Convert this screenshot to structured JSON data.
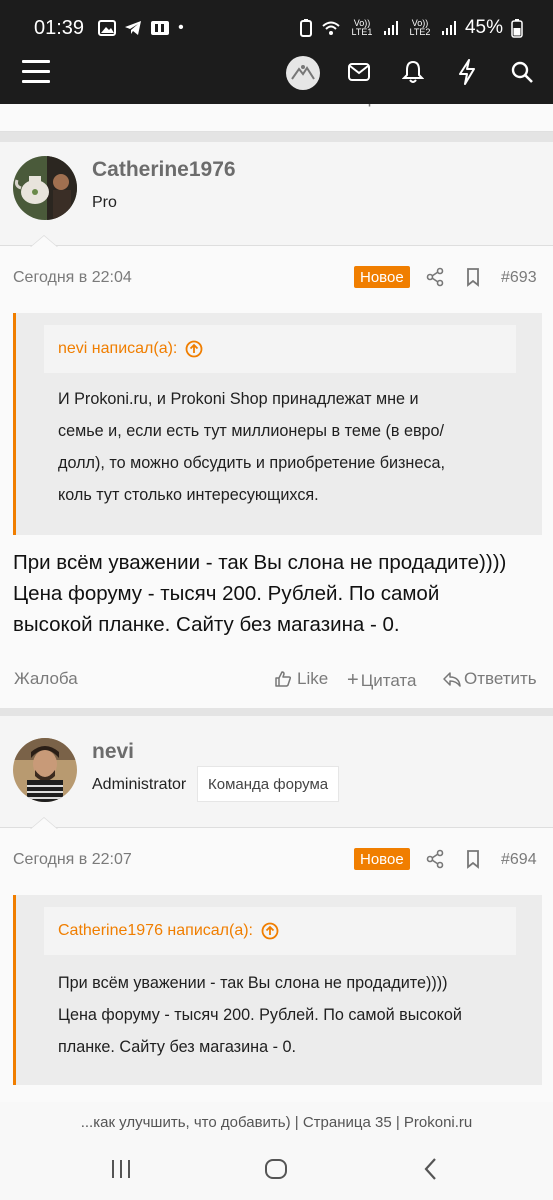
{
  "status_bar": {
    "time": "01:39",
    "dot": "•",
    "sim1_label": "Vo)) LTE1",
    "sim2_label": "Vo)) LTE2",
    "battery_percent": "45%"
  },
  "nav": {
    "icons": [
      "menu-icon",
      "site-logo-icon",
      "inbox-icon",
      "bell-icon",
      "bolt-icon",
      "search-icon"
    ]
  },
  "prev_post_footer": {
    "report": "Жалоба",
    "like": "Like",
    "quote": "Цитата",
    "reply": "Ответить"
  },
  "posts": [
    {
      "username": "Catherine1976",
      "user_title": "Pro",
      "user_badge": "",
      "time": "Сегодня в 22:04",
      "new_label": "Новое",
      "post_number": "#693",
      "quote_author": "nevi написал(а):",
      "quote_lines": [
        "И Prokoni.ru, и Prokoni Shop принадлежат мне и",
        "семье и, если есть тут миллионеры в теме (в евро/",
        "долл), то можно обсудить и приобретение бизнеса,",
        "коль тут столько интересующихся."
      ],
      "message_lines": [
        "При всём уважении - так Вы слона не продадите))))",
        "Цена форуму - тысяч 200. Рублей. По самой",
        "высокой планке. Сайту без магазина - 0."
      ],
      "report": "Жалоба",
      "like": "Like",
      "quote": "Цитата",
      "reply": "Ответить"
    },
    {
      "username": "nevi",
      "user_title": "Administrator",
      "user_badge": "Команда форума",
      "time": "Сегодня в 22:07",
      "new_label": "Новое",
      "post_number": "#694",
      "quote_author": "Catherine1976 написал(а):",
      "quote_lines": [
        "При всём уважении - так Вы слона не продадите))))",
        "Цена форуму - тысяч 200. Рублей. По самой высокой",
        "планке. Сайту без магазина - 0."
      ]
    }
  ],
  "page_title": "...как улучшить, что добавить) | Страница 35 | Prokoni.ru",
  "system_nav": [
    "recent-apps-icon",
    "home-icon",
    "back-icon"
  ],
  "colors": {
    "accent": "#f07e00",
    "topbar": "#1c1c1c",
    "page_bg": "#f2f2f2"
  }
}
